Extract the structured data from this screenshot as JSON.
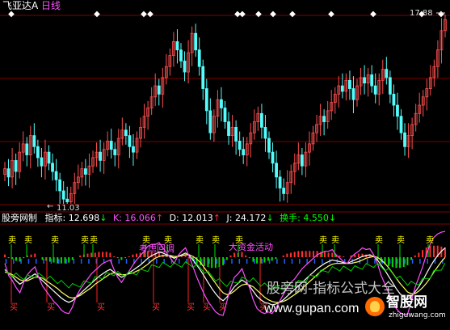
{
  "header": {
    "stock_name": "飞亚达A",
    "period": "日线",
    "max_price": "17.88",
    "min_price": "11.03"
  },
  "indicator": {
    "name": "股旁网制",
    "zhibiao_label": "指标:",
    "zhibiao_value": "12.698",
    "k_label": "K:",
    "k_value": "16.066",
    "d_label": "D:",
    "d_value": "12.013",
    "j_label": "J:",
    "j_value": "24.172",
    "turnover_label": "换手:",
    "turnover_value": "4.550",
    "arrow_down": "↓",
    "arrow_up": "↑"
  },
  "annotations": {
    "sell": "卖",
    "buy": "买",
    "note_a": "考虑回调",
    "note_b": "大资金活动"
  },
  "watermark": {
    "line1": "股旁网-指标公式大全",
    "line2": "www.gupan.com",
    "logo_big": "智股网",
    "logo_small": "zhiguwang.com"
  },
  "colors": {
    "background": "#000000",
    "up_candle": "#ff5050",
    "down_candle": "#54fcfc",
    "gridline": "#800000",
    "title_yellow": "#ffff00",
    "k_color": "#ff50ff",
    "j_color": "#ffff00",
    "turnover_color": "#00ff00",
    "note_color": "#ff50ff",
    "sell_color": "#ffff00",
    "buy_color": "#ff3030"
  },
  "chart_data": [
    {
      "type": "candlestick",
      "title": "飞亚达A 日线",
      "y_range": [
        11.03,
        17.88
      ],
      "close": [
        12.3,
        12.0,
        12.6,
        12.2,
        12.9,
        13.2,
        12.8,
        13.5,
        13.1,
        12.7,
        12.4,
        12.9,
        12.5,
        12.2,
        11.9,
        11.5,
        11.2,
        11.1,
        11.4,
        11.8,
        12.0,
        12.3,
        12.1,
        12.4,
        12.7,
        12.9,
        12.6,
        13.0,
        13.3,
        13.0,
        12.8,
        13.4,
        13.7,
        13.5,
        13.1,
        12.9,
        13.4,
        13.8,
        14.2,
        14.5,
        14.9,
        15.3,
        15.0,
        15.6,
        16.0,
        16.4,
        16.9,
        16.6,
        16.2,
        15.8,
        16.5,
        17.2,
        16.6,
        16.0,
        15.2,
        14.4,
        13.6,
        14.2,
        14.8,
        14.5,
        14.0,
        13.5,
        13.8,
        13.3,
        13.0,
        12.8,
        13.2,
        13.6,
        14.0,
        14.3,
        13.8,
        13.4,
        12.9,
        12.5,
        12.0,
        11.6,
        11.4,
        11.8,
        12.2,
        12.5,
        12.8,
        12.4,
        12.9,
        13.2,
        13.6,
        13.9,
        14.2,
        14.0,
        14.4,
        14.7,
        15.0,
        15.3,
        15.1,
        15.5,
        15.2,
        14.8,
        15.3,
        15.6,
        15.4,
        15.7,
        15.3,
        15.0,
        15.5,
        15.9,
        15.6,
        15.0,
        14.6,
        14.2,
        13.6,
        13.1,
        13.5,
        13.9,
        14.3,
        14.6,
        14.9,
        15.2,
        15.6,
        16.0,
        16.6,
        17.3,
        17.7
      ]
    },
    {
      "type": "line",
      "title": "股旁网制",
      "series": [
        {
          "name": "K",
          "values": [
            55,
            50,
            47,
            42,
            38,
            41,
            44,
            47,
            50,
            46,
            42,
            38,
            34,
            30,
            26,
            22,
            19,
            17,
            19,
            23,
            27,
            31,
            35,
            39,
            43,
            47,
            50,
            53,
            55,
            52,
            49,
            46,
            48,
            51,
            54,
            57,
            60,
            64,
            68,
            71,
            73,
            75,
            74,
            72,
            70,
            68,
            70,
            72,
            74,
            71,
            66,
            60,
            54,
            47,
            40,
            33,
            27,
            22,
            19,
            23,
            29,
            35,
            39,
            43,
            40,
            36,
            30,
            24,
            20,
            17,
            16,
            14,
            15,
            17,
            20,
            24,
            28,
            32,
            36,
            40,
            44,
            48,
            52,
            56,
            59,
            62,
            64,
            66,
            65,
            64,
            63,
            62,
            64,
            66,
            68,
            70,
            71,
            72,
            70,
            66,
            60,
            54,
            47,
            40,
            33,
            27,
            23,
            20,
            24,
            29,
            35,
            42,
            50,
            58,
            65,
            71,
            76,
            80
          ]
        },
        {
          "name": "D",
          "values": [
            52,
            51,
            49,
            46,
            43,
            42,
            42,
            44,
            46,
            46,
            45,
            42,
            39,
            36,
            33,
            29,
            26,
            23,
            22,
            23,
            25,
            28,
            31,
            34,
            38,
            41,
            44,
            47,
            50,
            51,
            50,
            49,
            49,
            50,
            51,
            53,
            55,
            58,
            61,
            65,
            68,
            70,
            71,
            71,
            71,
            70,
            70,
            71,
            72,
            72,
            70,
            67,
            63,
            57,
            51,
            45,
            39,
            33,
            28,
            26,
            27,
            30,
            34,
            37,
            38,
            37,
            35,
            31,
            27,
            23,
            20,
            18,
            17,
            17,
            18,
            20,
            23,
            26,
            29,
            33,
            37,
            41,
            45,
            49,
            53,
            56,
            59,
            61,
            62,
            62,
            62,
            62,
            62,
            63,
            64,
            66,
            68,
            69,
            70,
            69,
            66,
            62,
            57,
            51,
            45,
            39,
            34,
            29,
            27,
            27,
            30,
            34,
            39,
            45,
            52,
            58,
            64,
            69
          ]
        },
        {
          "name": "J",
          "values": [
            62,
            48,
            42,
            34,
            28,
            40,
            49,
            54,
            58,
            46,
            36,
            30,
            24,
            18,
            14,
            8,
            5,
            4,
            12,
            24,
            32,
            38,
            44,
            50,
            54,
            58,
            62,
            64,
            66,
            55,
            46,
            40,
            47,
            53,
            60,
            66,
            71,
            76,
            82,
            84,
            84,
            86,
            80,
            74,
            68,
            62,
            71,
            76,
            80,
            70,
            58,
            46,
            36,
            26,
            18,
            12,
            6,
            3,
            2,
            18,
            34,
            46,
            50,
            56,
            44,
            34,
            20,
            10,
            6,
            4,
            6,
            4,
            10,
            18,
            26,
            34,
            40,
            44,
            50,
            56,
            60,
            64,
            68,
            72,
            74,
            76,
            76,
            78,
            72,
            68,
            64,
            62,
            69,
            73,
            76,
            80,
            78,
            79,
            72,
            62,
            48,
            38,
            28,
            18,
            10,
            5,
            3,
            3,
            18,
            34,
            46,
            58,
            72,
            84,
            92,
            96,
            98,
            99
          ]
        }
      ]
    }
  ]
}
